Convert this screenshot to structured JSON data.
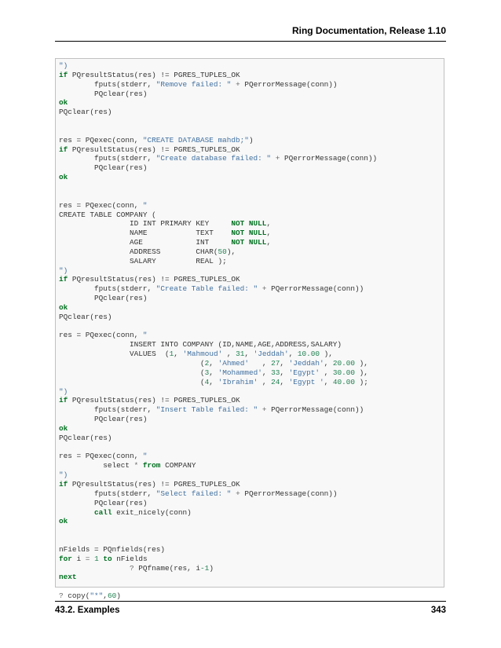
{
  "header": {
    "title": "Ring Documentation, Release 1.10"
  },
  "footer": {
    "section": "43.2. Examples",
    "page": "343"
  },
  "code": [
    [
      {
        "t": "\")",
        "c": "st"
      }
    ],
    [
      {
        "t": "if",
        "c": "kw"
      },
      {
        "t": " PQresultStatus(res) != PGRES_TUPLES_OK"
      }
    ],
    [
      {
        "t": "        fputs(stderr, "
      },
      {
        "t": "\"Remove failed: \"",
        "c": "st"
      },
      {
        "t": " "
      },
      {
        "t": "+",
        "c": "op"
      },
      {
        "t": " PQerrorMessage(conn))"
      }
    ],
    [
      {
        "t": "        PQclear(res)"
      }
    ],
    [
      {
        "t": "ok",
        "c": "kw"
      }
    ],
    [
      {
        "t": "PQclear(res)"
      }
    ],
    [],
    [],
    [
      {
        "t": "res = PQexec(conn, "
      },
      {
        "t": "\"CREATE DATABASE mahdb;\"",
        "c": "st"
      },
      {
        "t": ")"
      }
    ],
    [
      {
        "t": "if",
        "c": "kw"
      },
      {
        "t": " PQresultStatus(res) != PGRES_TUPLES_OK"
      }
    ],
    [
      {
        "t": "        fputs(stderr, "
      },
      {
        "t": "\"Create database failed: \"",
        "c": "st"
      },
      {
        "t": " "
      },
      {
        "t": "+",
        "c": "op"
      },
      {
        "t": " PQerrorMessage(conn))"
      }
    ],
    [
      {
        "t": "        PQclear(res)"
      }
    ],
    [
      {
        "t": "ok",
        "c": "kw"
      }
    ],
    [],
    [],
    [
      {
        "t": "res = PQexec(conn, "
      },
      {
        "t": "\"",
        "c": "st"
      }
    ],
    [
      {
        "t": "CREATE TABLE COMPANY ("
      }
    ],
    [
      {
        "t": "                ID INT PRIMARY KEY     "
      },
      {
        "t": "NOT NULL",
        "c": "kw"
      },
      {
        "t": ","
      }
    ],
    [
      {
        "t": "                NAME           TEXT    "
      },
      {
        "t": "NOT NULL",
        "c": "kw"
      },
      {
        "t": ","
      }
    ],
    [
      {
        "t": "                AGE            INT     "
      },
      {
        "t": "NOT NULL",
        "c": "kw"
      },
      {
        "t": ","
      }
    ],
    [
      {
        "t": "                ADDRESS        CHAR("
      },
      {
        "t": "50",
        "c": "nm"
      },
      {
        "t": "),"
      }
    ],
    [
      {
        "t": "                SALARY         REAL );"
      }
    ],
    [
      {
        "t": "\")",
        "c": "st"
      }
    ],
    [
      {
        "t": "if",
        "c": "kw"
      },
      {
        "t": " PQresultStatus(res) != PGRES_TUPLES_OK"
      }
    ],
    [
      {
        "t": "        fputs(stderr, "
      },
      {
        "t": "\"Create Table failed: \"",
        "c": "st"
      },
      {
        "t": " "
      },
      {
        "t": "+",
        "c": "op"
      },
      {
        "t": " PQerrorMessage(conn))"
      }
    ],
    [
      {
        "t": "        PQclear(res)"
      }
    ],
    [
      {
        "t": "ok",
        "c": "kw"
      }
    ],
    [
      {
        "t": "PQclear(res)"
      }
    ],
    [],
    [
      {
        "t": "res = PQexec(conn, "
      },
      {
        "t": "\"",
        "c": "st"
      }
    ],
    [
      {
        "t": "                INSERT INTO COMPANY (ID,NAME,AGE,ADDRESS,SALARY)"
      }
    ],
    [
      {
        "t": "                VALUES  ("
      },
      {
        "t": "1",
        "c": "nm"
      },
      {
        "t": ", "
      },
      {
        "t": "'Mahmoud'",
        "c": "st"
      },
      {
        "t": " , "
      },
      {
        "t": "31",
        "c": "nm"
      },
      {
        "t": ", "
      },
      {
        "t": "'Jeddah'",
        "c": "st"
      },
      {
        "t": ", "
      },
      {
        "t": "10.00",
        "c": "nm"
      },
      {
        "t": " ),"
      }
    ],
    [
      {
        "t": "                                ("
      },
      {
        "t": "2",
        "c": "nm"
      },
      {
        "t": ", "
      },
      {
        "t": "'Ahmed'",
        "c": "st"
      },
      {
        "t": "   , "
      },
      {
        "t": "27",
        "c": "nm"
      },
      {
        "t": ", "
      },
      {
        "t": "'Jeddah'",
        "c": "st"
      },
      {
        "t": ", "
      },
      {
        "t": "20.00",
        "c": "nm"
      },
      {
        "t": " ),"
      }
    ],
    [
      {
        "t": "                                ("
      },
      {
        "t": "3",
        "c": "nm"
      },
      {
        "t": ", "
      },
      {
        "t": "'Mohammed'",
        "c": "st"
      },
      {
        "t": ", "
      },
      {
        "t": "33",
        "c": "nm"
      },
      {
        "t": ", "
      },
      {
        "t": "'Egypt'",
        "c": "st"
      },
      {
        "t": " , "
      },
      {
        "t": "30.00",
        "c": "nm"
      },
      {
        "t": " ),"
      }
    ],
    [
      {
        "t": "                                ("
      },
      {
        "t": "4",
        "c": "nm"
      },
      {
        "t": ", "
      },
      {
        "t": "'Ibrahim'",
        "c": "st"
      },
      {
        "t": " , "
      },
      {
        "t": "24",
        "c": "nm"
      },
      {
        "t": ", "
      },
      {
        "t": "'Egypt '",
        "c": "st"
      },
      {
        "t": ", "
      },
      {
        "t": "40.00",
        "c": "nm"
      },
      {
        "t": " );"
      }
    ],
    [
      {
        "t": "\")",
        "c": "st"
      }
    ],
    [
      {
        "t": "if",
        "c": "kw"
      },
      {
        "t": " PQresultStatus(res) != PGRES_TUPLES_OK"
      }
    ],
    [
      {
        "t": "        fputs(stderr, "
      },
      {
        "t": "\"Insert Table failed: \"",
        "c": "st"
      },
      {
        "t": " "
      },
      {
        "t": "+",
        "c": "op"
      },
      {
        "t": " PQerrorMessage(conn))"
      }
    ],
    [
      {
        "t": "        PQclear(res)"
      }
    ],
    [
      {
        "t": "ok",
        "c": "kw"
      }
    ],
    [
      {
        "t": "PQclear(res)"
      }
    ],
    [],
    [
      {
        "t": "res = PQexec(conn, "
      },
      {
        "t": "\"",
        "c": "st"
      }
    ],
    [
      {
        "t": "          select "
      },
      {
        "t": "*",
        "c": "op"
      },
      {
        "t": " "
      },
      {
        "t": "from",
        "c": "kw"
      },
      {
        "t": " COMPANY"
      }
    ],
    [
      {
        "t": "\")",
        "c": "st"
      }
    ],
    [
      {
        "t": "if",
        "c": "kw"
      },
      {
        "t": " PQresultStatus(res) != PGRES_TUPLES_OK"
      }
    ],
    [
      {
        "t": "        fputs(stderr, "
      },
      {
        "t": "\"Select failed: \"",
        "c": "st"
      },
      {
        "t": " "
      },
      {
        "t": "+",
        "c": "op"
      },
      {
        "t": " PQerrorMessage(conn))"
      }
    ],
    [
      {
        "t": "        PQclear(res)"
      }
    ],
    [
      {
        "t": "        "
      },
      {
        "t": "call",
        "c": "kw"
      },
      {
        "t": " exit_nicely(conn)"
      }
    ],
    [
      {
        "t": "ok",
        "c": "kw"
      }
    ],
    [],
    [],
    [
      {
        "t": "nFields = PQnfields(res)"
      }
    ],
    [
      {
        "t": "for",
        "c": "kw"
      },
      {
        "t": " i "
      },
      {
        "t": "=",
        "c": "op"
      },
      {
        "t": " "
      },
      {
        "t": "1",
        "c": "nm"
      },
      {
        "t": " "
      },
      {
        "t": "to",
        "c": "kw"
      },
      {
        "t": " nFields"
      }
    ],
    [
      {
        "t": "                "
      },
      {
        "t": "?",
        "c": "op"
      },
      {
        "t": " PQfname(res, i"
      },
      {
        "t": "-1",
        "c": "nm"
      },
      {
        "t": ")"
      }
    ],
    [
      {
        "t": "next",
        "c": "kw"
      }
    ],
    [],
    [
      {
        "t": "?",
        "c": "op"
      },
      {
        "t": " copy("
      },
      {
        "t": "\"*\"",
        "c": "st"
      },
      {
        "t": ","
      },
      {
        "t": "60",
        "c": "nm"
      },
      {
        "t": ")"
      }
    ]
  ]
}
